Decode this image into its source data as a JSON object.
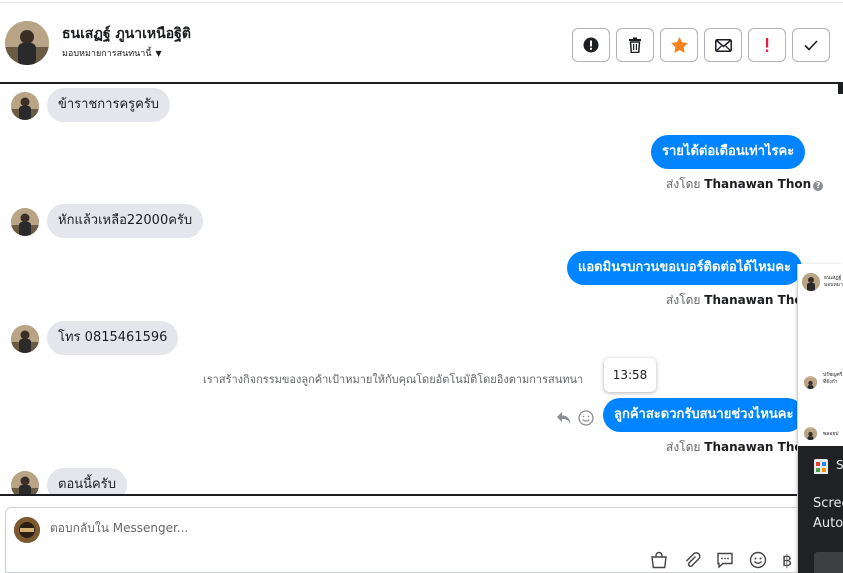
{
  "header": {
    "name": "ธนเสฏฐ์ ภูนาเหนือฐิติ",
    "assign_label": "มอบหมายการสนทนานี้",
    "actions": [
      {
        "icon": "alert-circle-icon"
      },
      {
        "icon": "trash-icon"
      },
      {
        "icon": "star-icon"
      },
      {
        "icon": "envelope-icon"
      },
      {
        "icon": "exclamation-icon"
      },
      {
        "icon": "check-icon"
      }
    ]
  },
  "messages": {
    "m1": "ข้าราชการครูครับ",
    "m2": "รายได้ต่อเดือนเท่าไรคะ",
    "m2_sent_prefix": "ส่งโดย",
    "m2_sent_name": "Thanawan Thon",
    "m3": "หักแล้วเหลือ22000ครับ",
    "m4": "แอดมินรบกวนขอเบอร์ติดต่อได้ไหมคะ",
    "m4_sent_prefix": "ส่งโดย",
    "m4_sent_name": "Thanawan Thon",
    "m5": "โทร 0815461596",
    "system_note": "เราสร้างกิจกรรมของลูกค้าเป้าหมายให้กับคุณโดยอัตโนมัติโดยอิงตามการสนทนา",
    "tooltip_time": "13:58",
    "m6": "ลูกค้าสะดวกรับสนายช่วงไหนคะ",
    "m6_sent_prefix": "ส่งโดย",
    "m6_sent_name": "Thanawan Thon",
    "m7": "ตอนนี้ครับ"
  },
  "composer": {
    "placeholder": "ตอบกลับใน Messenger..."
  },
  "side_panel": {
    "name_line1": "ธนเสฏฐ์",
    "name_line2": "มอบหมาย",
    "text_a1": "ปรัชญศรี",
    "text_a2": "ที่ยังกำ",
    "text_b": "พลอยป",
    "popup_title": "S",
    "popup_line1": "Scree",
    "popup_line2": "Auto"
  },
  "colors": {
    "accent": "#0084ff",
    "star": "#f5821f",
    "exclamation": "#e41e3f",
    "bubble_in": "#e4e6eb"
  }
}
